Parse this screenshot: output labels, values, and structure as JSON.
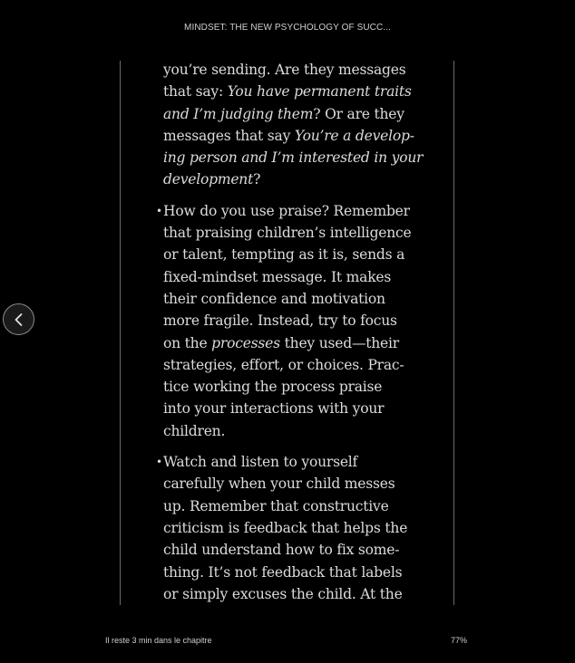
{
  "header": {
    "book_title": "MINDSET: THE NEW PSYCHOLOGY OF SUCC..."
  },
  "navigation": {
    "prev_icon": "chevron-left-icon"
  },
  "content": {
    "continuation": {
      "l1": "you’re sending. Are they messages",
      "l2a": "that say: ",
      "l2b": "You have permanent traits",
      "l3a": "and I’m judging them",
      "l3b": "? Or are they",
      "l4a": "messages that say ",
      "l4b": "You’re a develop-",
      "l5": "ing person and I’m interested in your",
      "l6a": "development",
      "l6b": "?"
    },
    "bullet_char": "•",
    "bullet1": {
      "l1": "How do you use praise? Remember",
      "l2": "that praising children’s intelligence",
      "l3": "or talent, tempting as it is, sends a",
      "l4": "fixed-mindset message. It makes",
      "l5": "their confidence and motivation",
      "l6": "more fragile. Instead, try to focus",
      "l7a": "on the ",
      "l7b": "processes",
      "l7c": " they used—their",
      "l8": "strategies, effort, or choices. Prac-",
      "l9": "tice working the process praise",
      "l10": "into your interactions with your",
      "l11": "children."
    },
    "bullet2": {
      "l1": "Watch and listen to yourself",
      "l2": "carefully when your child messes",
      "l3": "up. Remember that constructive",
      "l4": "criticism is feedback that helps the",
      "l5": "child understand how to fix some-",
      "l6": "thing. It’s not feedback that labels",
      "l7": "or simply excuses the child. At the"
    }
  },
  "footer": {
    "time_left": "Il reste 3 min dans le chapitre",
    "progress": "77%"
  }
}
